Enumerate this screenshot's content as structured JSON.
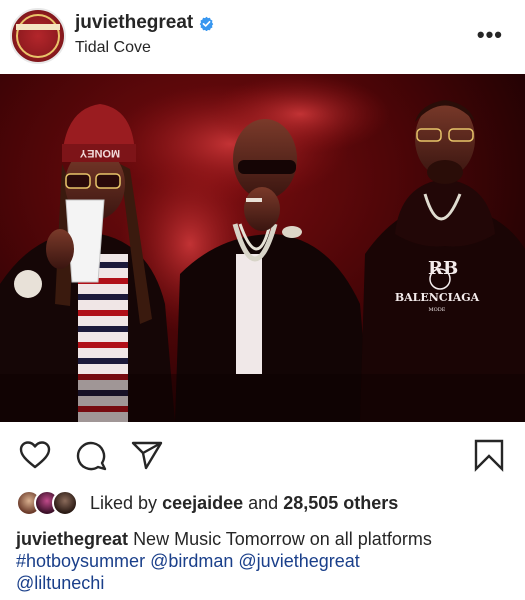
{
  "post": {
    "username": "juviethegreat",
    "location": "Tidal Cove",
    "verified_icon": "verified-badge-icon",
    "more_icon": "more-options-icon",
    "photo_text": {
      "hat_text": "MONEY",
      "hoodie_logo": "RB",
      "hoodie_brand": "BALENCIAGA",
      "hoodie_sub": "MODE"
    },
    "actions": {
      "like_icon": "heart-icon",
      "comment_icon": "comment-icon",
      "share_icon": "share-icon",
      "save_icon": "bookmark-icon"
    },
    "likes": {
      "prefix": "Liked by",
      "user": "ceejaidee",
      "middle": "and",
      "others": "28,505 others"
    },
    "caption": {
      "username": "juviethegreat",
      "text": "New Music Tomorrow on all platforms",
      "hashtag": "#hotboysummer",
      "mention1": "@birdman",
      "mention2": "@juviethegreat",
      "mention3": "@liltunechi"
    }
  },
  "colors": {
    "accent_blue": "#3897f0",
    "link": "#1a3f8a",
    "text": "#262626",
    "photo_red": "#7a0d10"
  }
}
